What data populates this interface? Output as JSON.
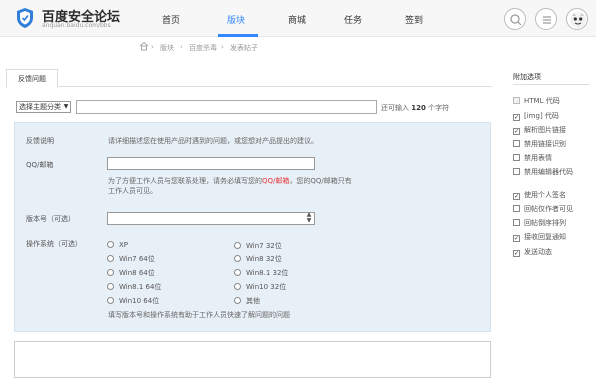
{
  "header": {
    "logo_title": "百度安全论坛",
    "logo_sub": "anquan.baidu.com/bbs",
    "nav": [
      "首页",
      "版块",
      "商城",
      "任务",
      "签到"
    ],
    "active_nav_index": 1,
    "accent": "#3388ff"
  },
  "breadcrumb": [
    "版块",
    "百度杀毒",
    "发表帖子"
  ],
  "composer": {
    "tab": "反馈问题",
    "topic_select": "选择主题分类",
    "remain_prefix": "还可输入",
    "remain_count": "120",
    "remain_suffix": "个字符"
  },
  "form": {
    "desc_label": "反馈说明",
    "desc_text": "请详细描述您在使用产品时遇到的问题，或您想对产品提出的建议。",
    "contact_label": "QQ/邮箱",
    "contact_hint_1": "为了方便工作人员与您联系处理，请务必填写您的",
    "contact_hint_hl": "QQ/邮箱",
    "contact_hint_2": "，您的QQ/邮箱只有",
    "contact_hint_line2": "工作人员可见。",
    "version_label": "版本号（可选）",
    "os_label": "操作系统（可选）",
    "os_options_col1": [
      "XP",
      "Win7 64位",
      "Win8 64位",
      "Win8.1 64位",
      "Win10 64位"
    ],
    "os_options_col2": [
      "Win7 32位",
      "Win8 32位",
      "Win8.1 32位",
      "Win10 32位",
      "其他"
    ],
    "os_note": "填写版本号和操作系统有助于工作人员快速了解问题的问题"
  },
  "sidebar": {
    "title": "附加选项",
    "options": [
      {
        "label": "HTML 代码",
        "checked": false,
        "disabled": true
      },
      {
        "label": "[img] 代码",
        "checked": true,
        "disabled": false
      },
      {
        "label": "解析图片链接",
        "checked": true,
        "disabled": false
      },
      {
        "label": "禁用链接识别",
        "checked": false,
        "disabled": false
      },
      {
        "label": "禁用表情",
        "checked": false,
        "disabled": false
      },
      {
        "label": "禁用编辑器代码",
        "checked": false,
        "disabled": false
      },
      {
        "label": "使用个人签名",
        "checked": true,
        "disabled": false
      },
      {
        "label": "回帖仅作者可见",
        "checked": false,
        "disabled": false
      },
      {
        "label": "回帖倒序排列",
        "checked": false,
        "disabled": false
      },
      {
        "label": "接收回复通知",
        "checked": true,
        "disabled": false
      },
      {
        "label": "发送动态",
        "checked": true,
        "disabled": false
      }
    ]
  }
}
